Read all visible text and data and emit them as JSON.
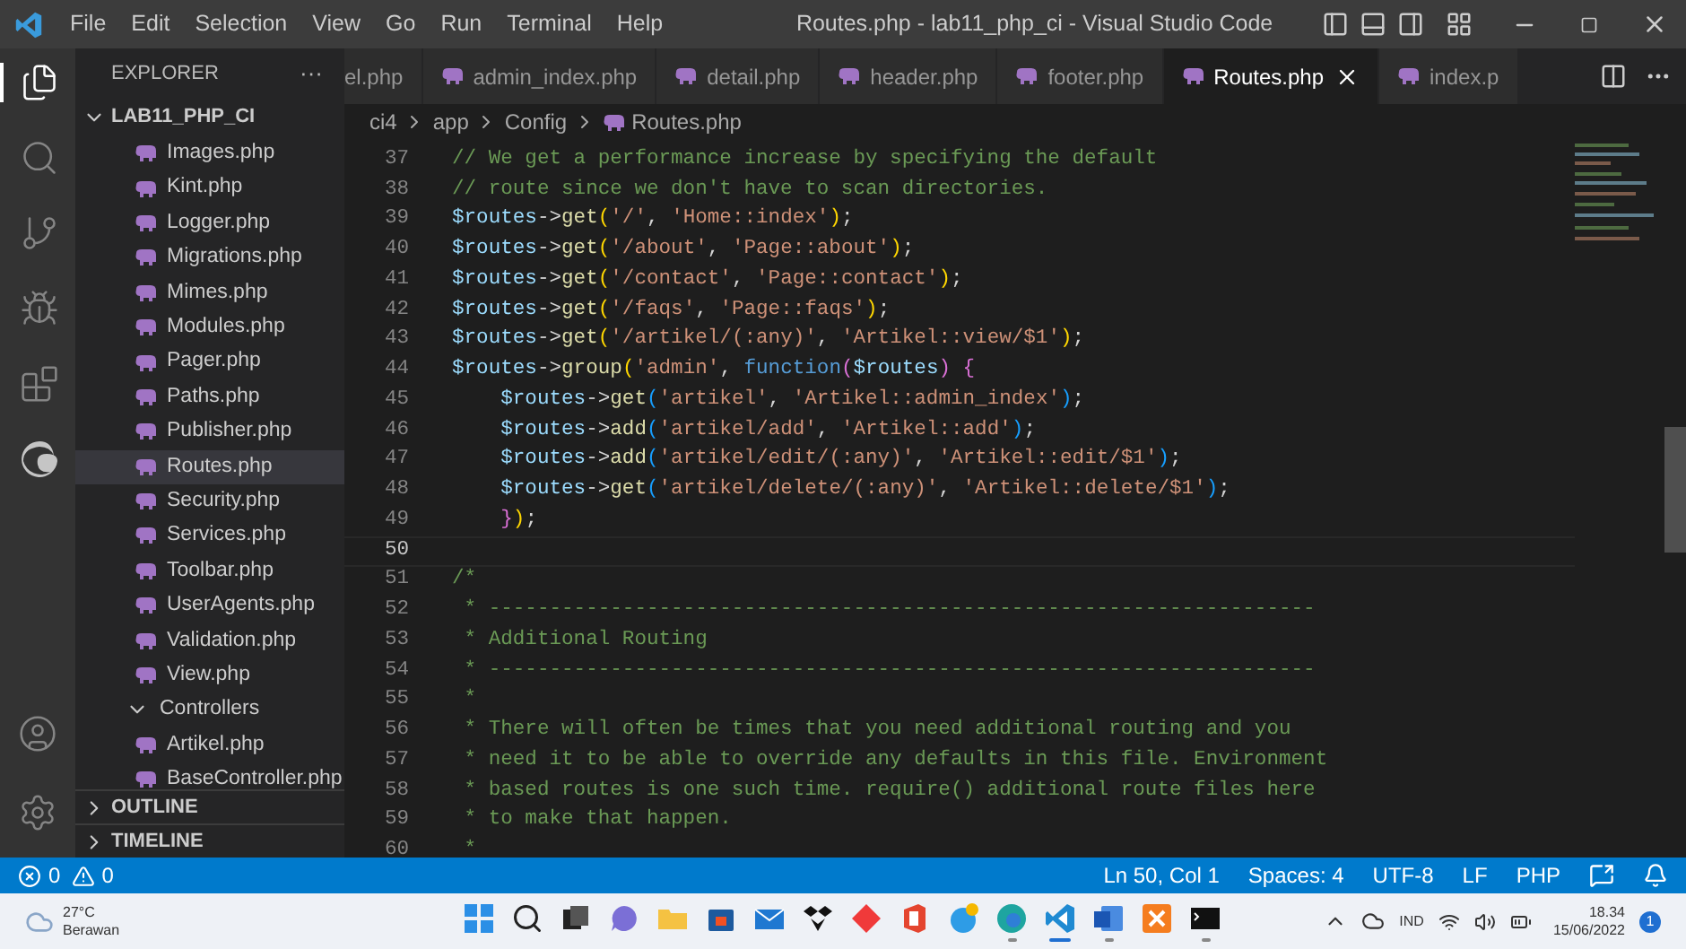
{
  "window": {
    "title": "Routes.php - lab11_php_ci - Visual Studio Code"
  },
  "menu": [
    "File",
    "Edit",
    "Selection",
    "View",
    "Go",
    "Run",
    "Terminal",
    "Help"
  ],
  "activity_bar": [
    {
      "kind": "files",
      "selected": true
    },
    {
      "kind": "search",
      "selected": false
    },
    {
      "kind": "source-control",
      "selected": false
    },
    {
      "kind": "run-debug",
      "selected": false
    },
    {
      "kind": "extensions",
      "selected": false
    },
    {
      "kind": "edge",
      "selected": false
    }
  ],
  "activity_bar_bottom": [
    {
      "kind": "account"
    },
    {
      "kind": "settings"
    }
  ],
  "explorer": {
    "title": "EXPLORER",
    "more": "···",
    "root": {
      "label": "LAB11_PHP_CI",
      "expanded": true,
      "children": [
        {
          "label": "Images.php",
          "selected": false
        },
        {
          "label": "Kint.php",
          "selected": false
        },
        {
          "label": "Logger.php",
          "selected": false
        },
        {
          "label": "Migrations.php",
          "selected": false
        },
        {
          "label": "Mimes.php",
          "selected": false
        },
        {
          "label": "Modules.php",
          "selected": false
        },
        {
          "label": "Pager.php",
          "selected": false
        },
        {
          "label": "Paths.php",
          "selected": false
        },
        {
          "label": "Publisher.php",
          "selected": false
        },
        {
          "label": "Routes.php",
          "selected": true
        },
        {
          "label": "Security.php",
          "selected": false
        },
        {
          "label": "Services.php",
          "selected": false
        },
        {
          "label": "Toolbar.php",
          "selected": false
        },
        {
          "label": "UserAgents.php",
          "selected": false
        },
        {
          "label": "Validation.php",
          "selected": false
        },
        {
          "label": "View.php",
          "selected": false
        },
        {
          "label": "Controllers",
          "selected": false,
          "expanded": true,
          "children": [
            {
              "label": "Artikel.php",
              "selected": false
            },
            {
              "label": "BaseController.php",
              "selected": false
            }
          ]
        }
      ]
    }
  },
  "panels": [
    {
      "label": "OUTLINE",
      "expanded": false
    },
    {
      "label": "TIMELINE",
      "expanded": false
    }
  ],
  "tabs": [
    {
      "label": "el.php",
      "selected": false
    },
    {
      "label": "admin_index.php",
      "selected": false
    },
    {
      "label": "detail.php",
      "selected": false
    },
    {
      "label": "header.php",
      "selected": false
    },
    {
      "label": "footer.php",
      "selected": false
    },
    {
      "label": "Routes.php",
      "selected": true
    },
    {
      "label": "index.p",
      "selected": false
    }
  ],
  "breadcrumbs": [
    "ci4",
    "app",
    "Config",
    "Routes.php"
  ],
  "code": [
    {
      "n": "37",
      "current": false,
      "text": "// We get a performance increase by specifying the default"
    },
    {
      "n": "38",
      "current": false,
      "text": "// route since we don't have to scan directories."
    },
    {
      "n": "39",
      "current": false,
      "text": "$routes->get('/', 'Home::index');"
    },
    {
      "n": "40",
      "current": false,
      "text": "$routes->get('/about', 'Page::about');"
    },
    {
      "n": "41",
      "current": false,
      "text": "$routes->get('/contact', 'Page::contact');"
    },
    {
      "n": "42",
      "current": false,
      "text": "$routes->get('/faqs', 'Page::faqs');"
    },
    {
      "n": "43",
      "current": false,
      "text": "$routes->get('/artikel/(:any)', 'Artikel::view/$1');"
    },
    {
      "n": "44",
      "current": false,
      "text": "$routes->group('admin', function($routes) {"
    },
    {
      "n": "45",
      "current": false,
      "text": "    $routes->get('artikel', 'Artikel::admin_index');"
    },
    {
      "n": "46",
      "current": false,
      "text": "    $routes->add('artikel/add', 'Artikel::add');"
    },
    {
      "n": "47",
      "current": false,
      "text": "    $routes->add('artikel/edit/(:any)', 'Artikel::edit/$1');"
    },
    {
      "n": "48",
      "current": false,
      "text": "    $routes->get('artikel/delete/(:any)', 'Artikel::delete/$1');"
    },
    {
      "n": "49",
      "current": false,
      "text": "    });"
    },
    {
      "n": "50",
      "current": true
    },
    {
      "n": "51",
      "current": false,
      "text": "/*"
    },
    {
      "n": "52",
      "current": false,
      "text": " * --------------------------------------------------------------------"
    },
    {
      "n": "53",
      "current": false,
      "text": " * Additional Routing"
    },
    {
      "n": "54",
      "current": false,
      "text": " * --------------------------------------------------------------------"
    },
    {
      "n": "55",
      "current": false,
      "text": " *"
    },
    {
      "n": "56",
      "current": false,
      "text": " * There will often be times that you need additional routing and you"
    },
    {
      "n": "57",
      "current": false,
      "text": " * need it to be able to override any defaults in this file. Environment"
    },
    {
      "n": "58",
      "current": false,
      "text": " * based routes is one such time. require() additional route files here"
    },
    {
      "n": "59",
      "current": false,
      "text": " * to make that happen."
    },
    {
      "n": "60",
      "current": false,
      "text": " *"
    }
  ],
  "status_bar": {
    "errors": "0",
    "warnings": "0",
    "items": [
      "Ln 50, Col 1",
      "Spaces: 4",
      "UTF-8",
      "LF",
      "PHP"
    ]
  },
  "taskbar": {
    "weather": {
      "temp": "27°C",
      "text": "Berawan"
    },
    "apps": [
      {
        "kind": "start",
        "running": false
      },
      {
        "kind": "search",
        "running": false
      },
      {
        "kind": "task-view",
        "running": false
      },
      {
        "kind": "chat",
        "running": false
      },
      {
        "kind": "folder",
        "running": false
      },
      {
        "kind": "store",
        "running": false
      },
      {
        "kind": "mail",
        "running": false
      },
      {
        "kind": "box",
        "running": false
      },
      {
        "kind": "diamond",
        "running": false
      },
      {
        "kind": "office",
        "running": false
      },
      {
        "kind": "globe",
        "running": false
      },
      {
        "kind": "edge",
        "running": true
      },
      {
        "kind": "code",
        "running": true,
        "selected": true
      },
      {
        "kind": "word",
        "running": true
      },
      {
        "kind": "xampp",
        "running": false
      },
      {
        "kind": "terminal",
        "running": true
      }
    ],
    "language": "IND",
    "time": "18.34",
    "date": "15/06/2022",
    "notifications": "1"
  }
}
